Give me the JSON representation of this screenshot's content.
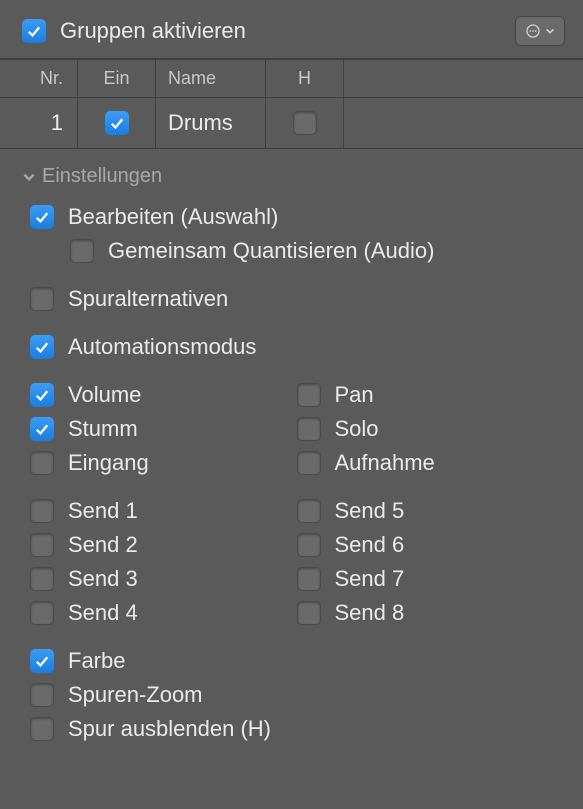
{
  "header": {
    "title": "Gruppen aktivieren",
    "checked": true
  },
  "table": {
    "columns": {
      "nr": "Nr.",
      "ein": "Ein",
      "name": "Name",
      "h": "H"
    },
    "rows": [
      {
        "nr": "1",
        "ein": true,
        "name": "Drums",
        "h": false
      }
    ]
  },
  "settings": {
    "title": "Einstellungen",
    "edit": {
      "label": "Bearbeiten (Auswahl)",
      "checked": true
    },
    "quantize": {
      "label": "Gemeinsam Quantisieren (Audio)",
      "checked": false
    },
    "trackAlt": {
      "label": "Spuralternativen",
      "checked": false
    },
    "autoMode": {
      "label": "Automationsmodus",
      "checked": true
    },
    "volume": {
      "label": "Volume",
      "checked": true
    },
    "pan": {
      "label": "Pan",
      "checked": false
    },
    "mute": {
      "label": "Stumm",
      "checked": true
    },
    "solo": {
      "label": "Solo",
      "checked": false
    },
    "input": {
      "label": "Eingang",
      "checked": false
    },
    "record": {
      "label": "Aufnahme",
      "checked": false
    },
    "send1": {
      "label": "Send 1",
      "checked": false
    },
    "send2": {
      "label": "Send 2",
      "checked": false
    },
    "send3": {
      "label": "Send 3",
      "checked": false
    },
    "send4": {
      "label": "Send 4",
      "checked": false
    },
    "send5": {
      "label": "Send 5",
      "checked": false
    },
    "send6": {
      "label": "Send 6",
      "checked": false
    },
    "send7": {
      "label": "Send 7",
      "checked": false
    },
    "send8": {
      "label": "Send 8",
      "checked": false
    },
    "color": {
      "label": "Farbe",
      "checked": true
    },
    "zoom": {
      "label": "Spuren-Zoom",
      "checked": false
    },
    "hide": {
      "label": "Spur ausblenden (H)",
      "checked": false
    }
  }
}
